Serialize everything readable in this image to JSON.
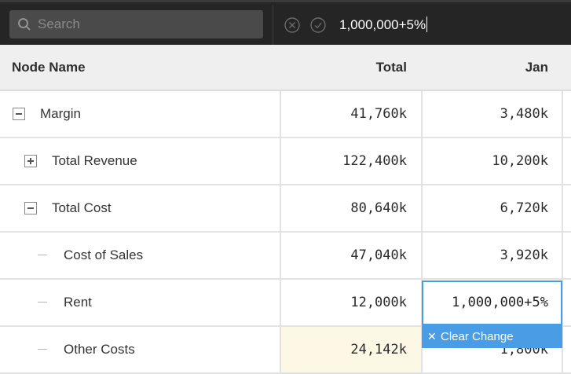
{
  "toolbar": {
    "search_placeholder": "Search",
    "formula_value": "1,000,000+5%",
    "cancel_icon": "x-circle-icon",
    "confirm_icon": "check-circle-icon"
  },
  "columns": {
    "name": "Node Name",
    "total": "Total",
    "jan": "Jan"
  },
  "rows": [
    {
      "name": "Margin",
      "toggle": "minus",
      "total": "41,760k",
      "jan": "3,480k"
    },
    {
      "name": "Total Revenue",
      "toggle": "plus",
      "total": "122,400k",
      "jan": "10,200k"
    },
    {
      "name": "Total Cost",
      "toggle": "minus",
      "total": "80,640k",
      "jan": "6,720k"
    },
    {
      "name": "Cost of Sales",
      "toggle": "leaf",
      "total": "47,040k",
      "jan": "3,920k"
    },
    {
      "name": "Rent",
      "toggle": "leaf",
      "total": "12,000k",
      "jan": "1,000,000+5%"
    },
    {
      "name": "Other Costs",
      "toggle": "leaf",
      "total": "24,142k",
      "jan": "1,800k"
    }
  ],
  "editor": {
    "value": "1,000,000+5%",
    "clear_label": "Clear Change"
  },
  "colors": {
    "accent": "#4a9de4",
    "toolbar_bg": "#252525",
    "header_bg": "#efefef",
    "changed_cell_bg": "#fdf8e6"
  }
}
